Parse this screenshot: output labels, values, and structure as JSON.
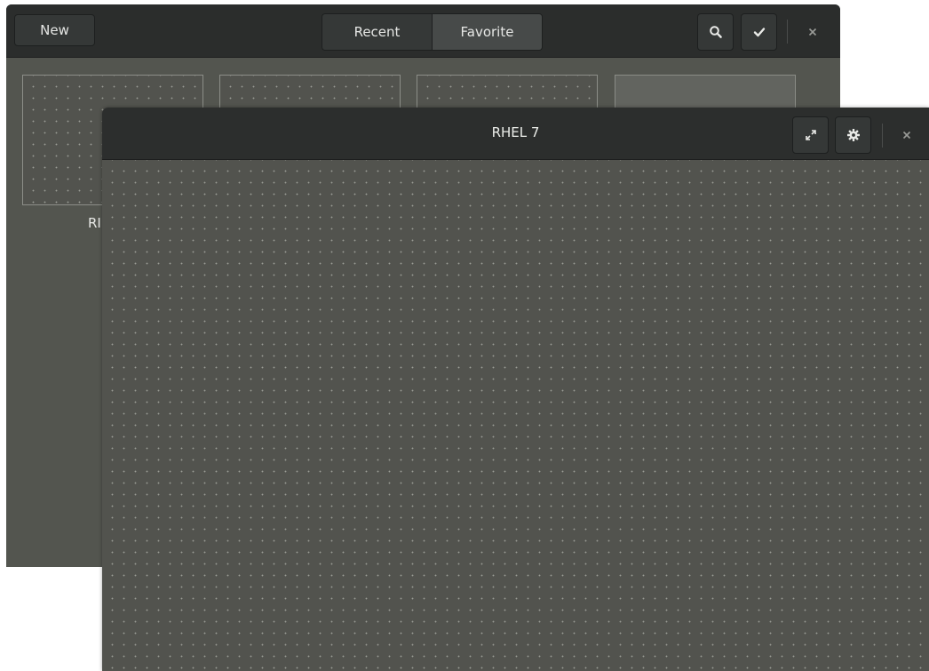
{
  "back_window": {
    "new_label": "New",
    "tabs": [
      {
        "label": "Recent",
        "active": false
      },
      {
        "label": "Favorite",
        "active": true
      }
    ],
    "icons": {
      "search": "search-icon",
      "select": "checkmark-icon",
      "close": "close-icon"
    },
    "thumbnail_label": "RI"
  },
  "front_window": {
    "title": "RHEL 7",
    "icons": {
      "fullscreen": "fullscreen-icon",
      "settings": "gear-icon",
      "close": "close-icon"
    }
  },
  "colors": {
    "header": "#2b2d2c",
    "content": "#52534e",
    "button": "#353837",
    "button_active": "#474a49"
  }
}
